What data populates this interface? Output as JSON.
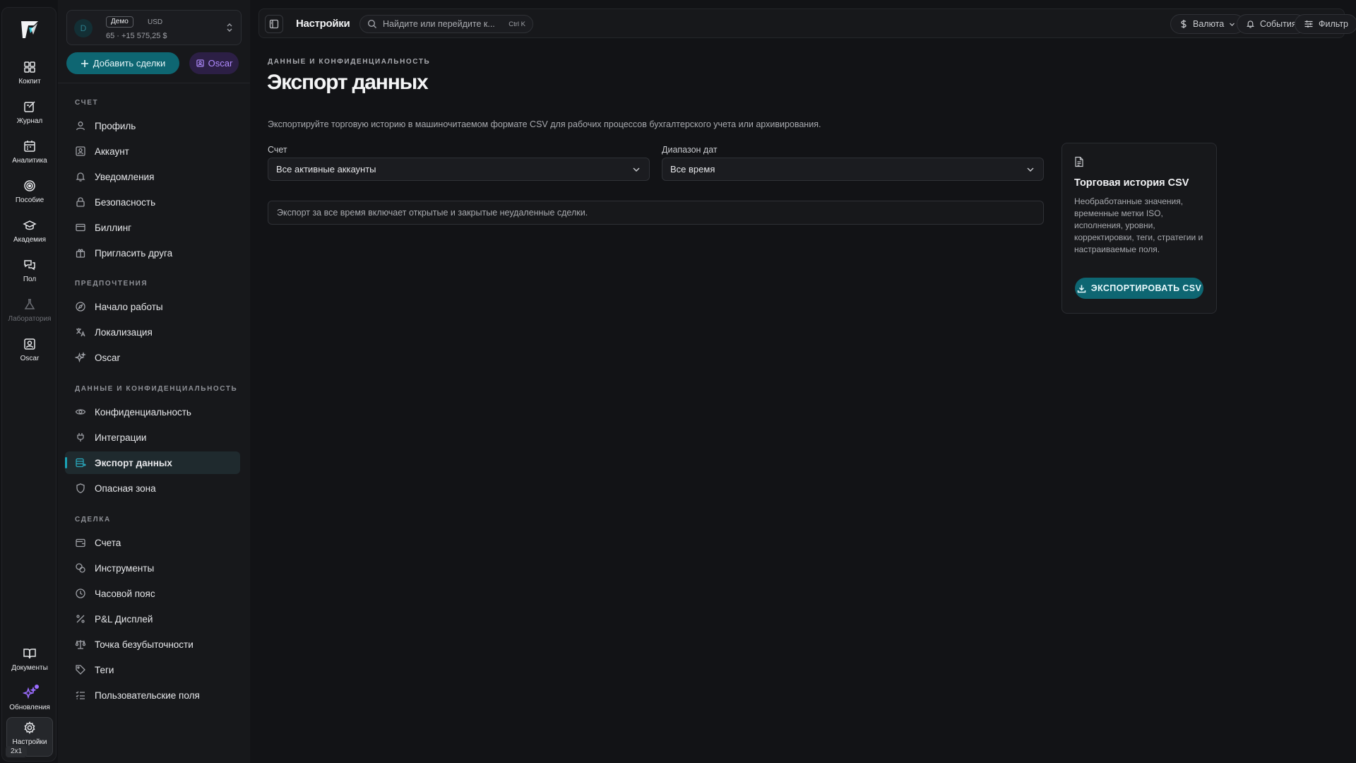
{
  "rail": {
    "items": [
      {
        "label": "Кокпит",
        "icon": "dashboard-icon"
      },
      {
        "label": "Журнал",
        "icon": "journal-icon"
      },
      {
        "label": "Аналитика",
        "icon": "calendar-icon"
      },
      {
        "label": "Пособие",
        "icon": "target-icon"
      },
      {
        "label": "Академия",
        "icon": "graduation-cap-icon"
      },
      {
        "label": "Пол",
        "icon": "chat-icon"
      },
      {
        "label": "Лаборатория",
        "icon": "flask-icon"
      },
      {
        "label": "Oscar",
        "icon": "oscar-icon"
      }
    ],
    "bottom": [
      {
        "label": "Документы",
        "icon": "book-icon"
      },
      {
        "label": "Обновления",
        "icon": "sparkles-icon"
      },
      {
        "label": "Настройки",
        "icon": "gear-icon"
      }
    ],
    "size_badge": "2x1"
  },
  "account": {
    "avatar": "D",
    "tag": "Демо",
    "currency": "USD",
    "summary": "65 · +15 575,25 $"
  },
  "actions": {
    "add_trades": "Добавить сделки",
    "oscar": "Oscar"
  },
  "sidebar": {
    "sections": [
      {
        "title": "СЧЕТ",
        "items": [
          "Профиль",
          "Аккаунт",
          "Уведомления",
          "Безопасность",
          "Биллинг",
          "Пригласить друга"
        ]
      },
      {
        "title": "ПРЕДПОЧТЕНИЯ",
        "items": [
          "Начало работы",
          "Локализация",
          "Oscar"
        ]
      },
      {
        "title": "ДАННЫЕ И КОНФИДЕНЦИАЛЬНОСТЬ",
        "items": [
          "Конфиденциальность",
          "Интеграции",
          "Экспорт данных",
          "Опасная зона"
        ]
      },
      {
        "title": "СДЕЛКА",
        "items": [
          "Счета",
          "Инструменты",
          "Часовой пояс",
          "P&L Дисплей",
          "Точка безубыточности",
          "Теги",
          "Пользовательские поля"
        ]
      }
    ]
  },
  "topbar": {
    "title": "Настройки",
    "search_placeholder": "Найдите или перейдите к...",
    "search_shortcut": "Ctrl K",
    "currency": "Валюта",
    "events": "События",
    "filter": "Фильтр"
  },
  "page": {
    "breadcrumb": "ДАННЫЕ И КОНФИДЕНЦИАЛЬНОСТЬ",
    "title": "Экспорт данных",
    "description": "Экспортируйте торговую историю в машиночитаемом формате CSV для рабочих процессов бухгалтерского учета или архивирования.",
    "account_label": "Счет",
    "account_value": "Все активные аккаунты",
    "range_label": "Диапазон дат",
    "range_value": "Все время",
    "note": "Экспорт за все время включает открытые и закрытые неудаленные сделки."
  },
  "card": {
    "title": "Торговая история CSV",
    "text": "Необработанные значения, временные метки ISO, исполнения, уровни, корректировки, теги, стратегии и настраиваемые поля.",
    "button": "ЭКСПОРТИРОВАТЬ CSV"
  },
  "colors": {
    "accent": "#0e6672",
    "oscar": "#b18cff",
    "background": "#121316"
  }
}
